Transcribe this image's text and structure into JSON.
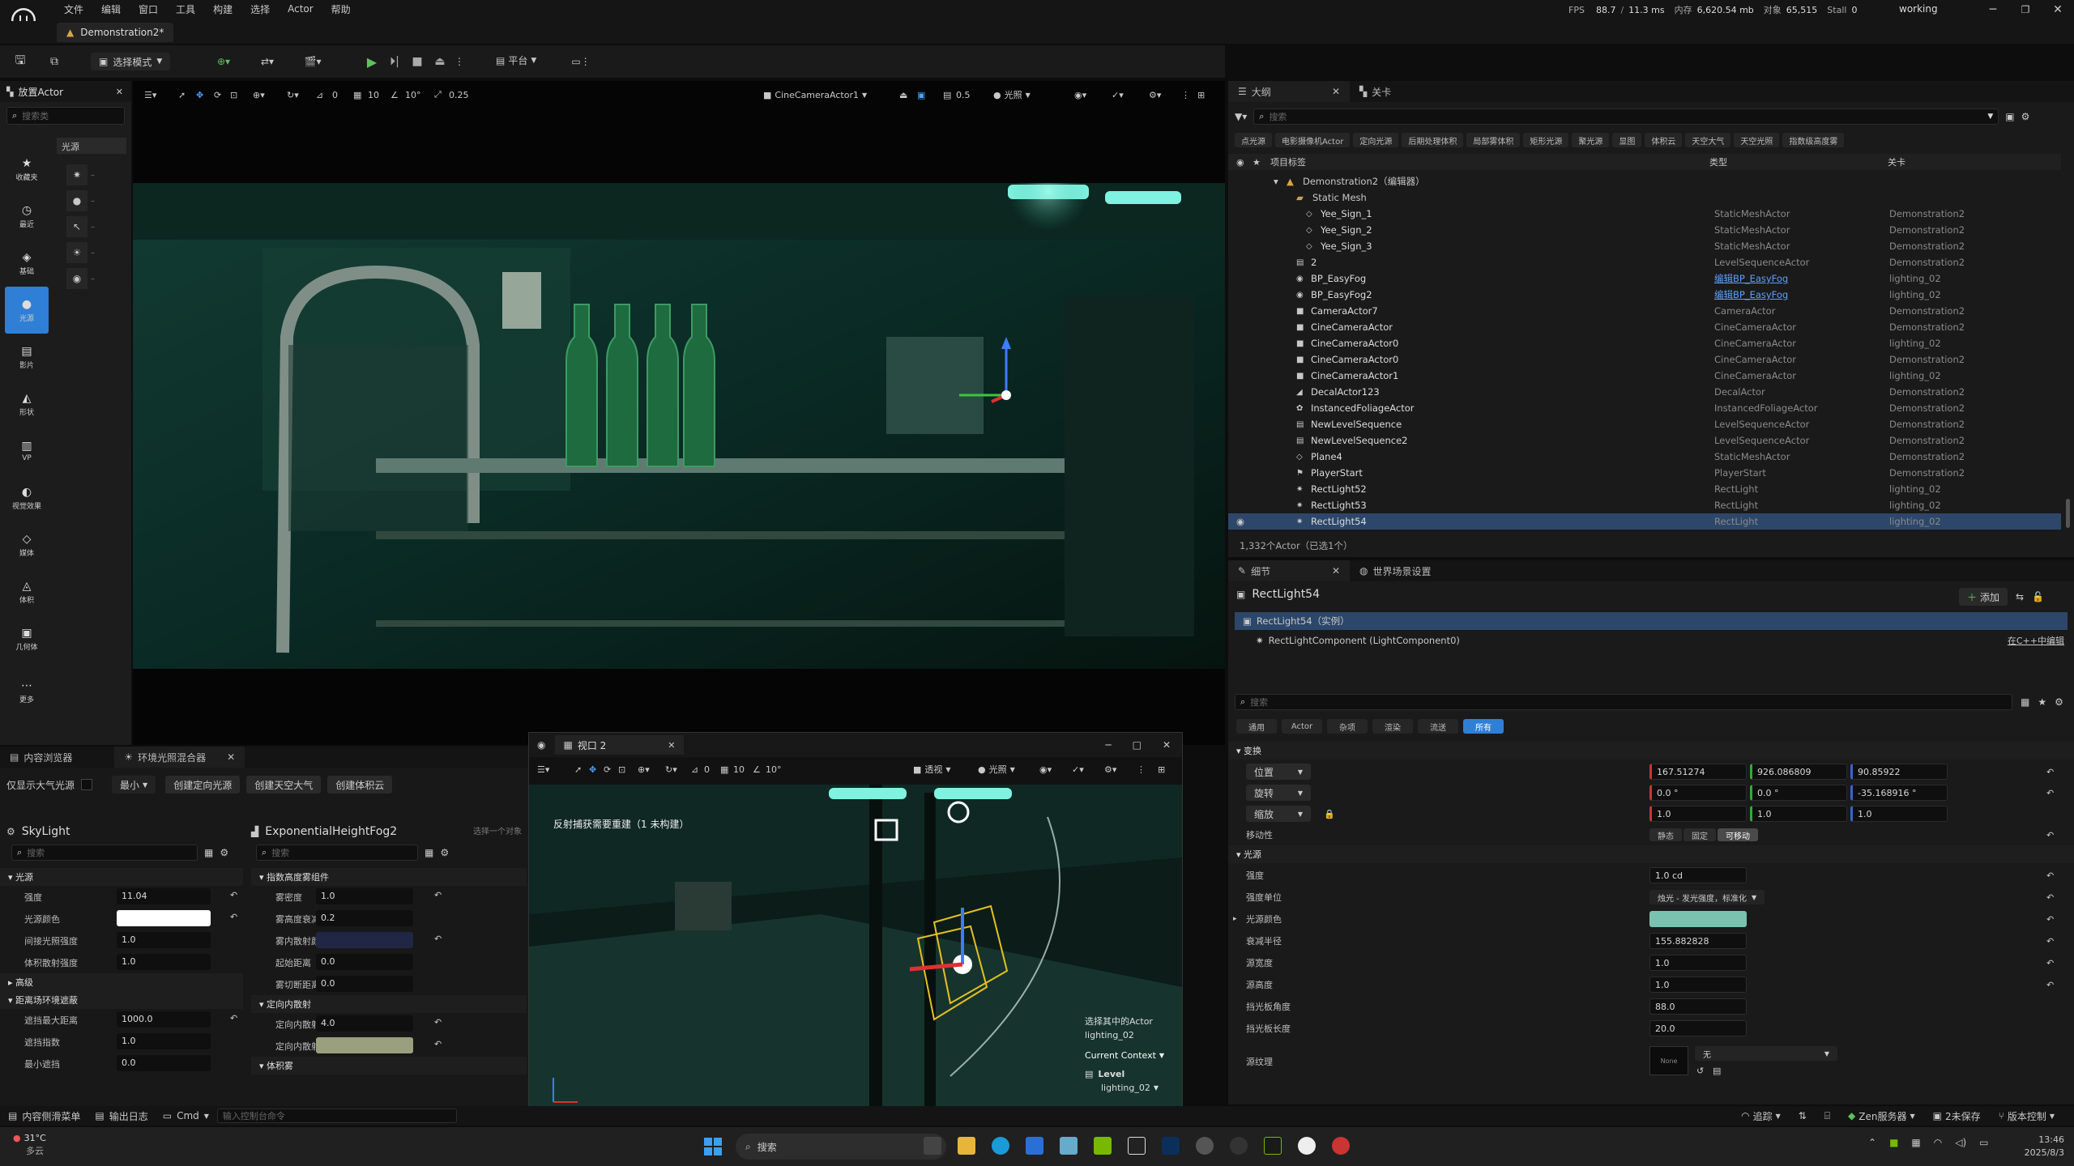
{
  "menu": {
    "items": [
      "文件",
      "编辑",
      "窗口",
      "工具",
      "构建",
      "选择",
      "Actor",
      "帮助"
    ],
    "fps_label": "FPS",
    "fps": "88.7",
    "frame_ms": "11.3 ms",
    "mem_label": "内存",
    "mem": "6,620.54 mb",
    "obj_label": "对象",
    "obj": "65,515",
    "stall_label": "Stall",
    "stall": "0",
    "status": "working"
  },
  "doc_tab": "Demonstration2*",
  "toolbar": {
    "select_mode": "选择模式",
    "platform": "平台"
  },
  "place_panel": {
    "tab": "放置Actor",
    "search_placeholder": "搜索类",
    "category_header": "光源",
    "categories": [
      "收藏夹",
      "最近",
      "基础",
      "光源",
      "影片",
      "形状",
      "VP",
      "视觉效果",
      "媒体",
      "体积",
      "几何体",
      "更多"
    ]
  },
  "viewport": {
    "camera": "CineCameraActor1",
    "snap_move": "10",
    "snap_rot": "10°",
    "snap_scale": "0.25",
    "speed": "0.5",
    "lit": "光照",
    "count_a": "0",
    "count_b": "10"
  },
  "viewport2": {
    "title": "视口 2",
    "perspective": "透视",
    "lit": "光照",
    "warning": "反射捕获需要重建（1 未构建）",
    "snap_a": "0",
    "snap_b": "10",
    "snap_c": "10°",
    "info_line1": "选择其中的Actor",
    "info_line2": "lighting_02",
    "context_label": "Current Context",
    "level_label": "Level",
    "level_value": "lighting_02"
  },
  "content_browser": {
    "tab1": "内容浏览器",
    "tab2": "环境光照混合器",
    "only_env": "仅显示大气光源",
    "min_label": "最小",
    "btn_dirlight": "创建定向光源",
    "btn_sky": "创建天空大气",
    "btn_volcloud": "创建体积云",
    "skylight": {
      "title": "SkyLight",
      "search": "搜索",
      "sec_light": "光源",
      "rows": [
        {
          "label": "强度",
          "value": "11.04"
        },
        {
          "label": "光源颜色",
          "value": ""
        },
        {
          "label": "间接光照强度",
          "value": "1.0"
        },
        {
          "label": "体积散射强度",
          "value": "1.0"
        }
      ],
      "sec_adv": "高级",
      "sec_dist": "距离场环境遮蔽",
      "rows2": [
        {
          "label": "遮挡最大距离",
          "value": "1000.0"
        },
        {
          "label": "遮挡指数",
          "value": "1.0"
        },
        {
          "label": "最小遮挡",
          "value": "0.0"
        }
      ]
    },
    "fog": {
      "title": "ExponentialHeightFog2",
      "search": "搜索",
      "hint": "选择一个对象",
      "sec_exp": "指数高度雾组件",
      "rows": [
        {
          "label": "雾密度",
          "value": "1.0"
        },
        {
          "label": "雾高度衰减",
          "value": "0.2"
        },
        {
          "label": "雾内散射颜色",
          "value": ""
        },
        {
          "label": "起始距离",
          "value": "0.0"
        },
        {
          "label": "雾切断距离",
          "value": "0.0"
        }
      ],
      "sec_dir": "定向内散射",
      "rows2": [
        {
          "label": "定向内散射指数",
          "value": "4.0"
        },
        {
          "label": "定向内散射颜色",
          "value": ""
        }
      ],
      "sec_vol": "体积雾"
    }
  },
  "outliner": {
    "tab1": "大纲",
    "tab2": "关卡",
    "search": "搜索",
    "filters": [
      "点光源",
      "电影摄像机Actor",
      "定向光源",
      "后期处理体积",
      "局部雾体积",
      "矩形光源",
      "聚光源",
      "显图",
      "体积云",
      "天空大气",
      "天空光照",
      "指数级高度雾"
    ],
    "col_label": "项目标签",
    "col_type": "类型",
    "col_level": "关卡",
    "root": "Demonstration2（编辑器）",
    "folder": "Static Mesh",
    "rows": [
      {
        "name": "Yee_Sign_1",
        "type": "StaticMeshActor",
        "level": "Demonstration2",
        "indent": 3
      },
      {
        "name": "Yee_Sign_2",
        "type": "StaticMeshActor",
        "level": "Demonstration2",
        "indent": 3
      },
      {
        "name": "Yee_Sign_3",
        "type": "StaticMeshActor",
        "level": "Demonstration2",
        "indent": 3
      },
      {
        "name": "2",
        "type": "LevelSequenceActor",
        "level": "Demonstration2",
        "indent": 2
      },
      {
        "name": "BP_EasyFog",
        "type": "编辑BP_EasyFog",
        "level": "lighting_02",
        "indent": 2,
        "link": true
      },
      {
        "name": "BP_EasyFog2",
        "type": "编辑BP_EasyFog",
        "level": "lighting_02",
        "indent": 2,
        "link": true
      },
      {
        "name": "CameraActor7",
        "type": "CameraActor",
        "level": "Demonstration2",
        "indent": 2
      },
      {
        "name": "CineCameraActor",
        "type": "CineCameraActor",
        "level": "Demonstration2",
        "indent": 2
      },
      {
        "name": "CineCameraActor0",
        "type": "CineCameraActor",
        "level": "lighting_02",
        "indent": 2
      },
      {
        "name": "CineCameraActor0",
        "type": "CineCameraActor",
        "level": "Demonstration2",
        "indent": 2
      },
      {
        "name": "CineCameraActor1",
        "type": "CineCameraActor",
        "level": "lighting_02",
        "indent": 2
      },
      {
        "name": "DecalActor123",
        "type": "DecalActor",
        "level": "Demonstration2",
        "indent": 2
      },
      {
        "name": "InstancedFoliageActor",
        "type": "InstancedFoliageActor",
        "level": "Demonstration2",
        "indent": 2
      },
      {
        "name": "NewLevelSequence",
        "type": "LevelSequenceActor",
        "level": "Demonstration2",
        "indent": 2
      },
      {
        "name": "NewLevelSequence2",
        "type": "LevelSequenceActor",
        "level": "Demonstration2",
        "indent": 2
      },
      {
        "name": "Plane4",
        "type": "StaticMeshActor",
        "level": "Demonstration2",
        "indent": 2
      },
      {
        "name": "PlayerStart",
        "type": "PlayerStart",
        "level": "Demonstration2",
        "indent": 2
      },
      {
        "name": "RectLight52",
        "type": "RectLight",
        "level": "lighting_02",
        "indent": 2
      },
      {
        "name": "RectLight53",
        "type": "RectLight",
        "level": "lighting_02",
        "indent": 2
      },
      {
        "name": "RectLight54",
        "type": "RectLight",
        "level": "lighting_02",
        "indent": 2,
        "selected": true
      }
    ],
    "footer": "1,332个Actor（已选1个）"
  },
  "details": {
    "tab1": "细节",
    "tab2": "世界场景设置",
    "actor_name": "RectLight54",
    "add_label": "添加",
    "instance": "RectLight54（实例）",
    "component": "RectLightComponent (LightComponent0)",
    "edit_cpp": "在C++中编辑",
    "search": "搜索",
    "filter_tabs": [
      "通用",
      "Actor",
      "杂项",
      "渲染",
      "流送",
      "所有"
    ],
    "sec_transform": "变换",
    "location_label": "位置",
    "location": [
      "167.51274",
      "926.086809",
      "90.85922"
    ],
    "rotation_label": "旋转",
    "rotation": [
      "0.0 °",
      "0.0 °",
      "-35.168916 °"
    ],
    "scale_label": "缩放",
    "scale": [
      "1.0",
      "1.0",
      "1.0"
    ],
    "mobility_label": "移动性",
    "mobility": [
      "静态",
      "固定",
      "可移动"
    ],
    "sec_light": "光源",
    "props": [
      {
        "label": "强度",
        "value": "1.0 cd"
      },
      {
        "label": "强度单位",
        "value": "烛光 - 发光强度，标准化"
      },
      {
        "label": "光源颜色",
        "value": ""
      },
      {
        "label": "衰减半径",
        "value": "155.882828"
      },
      {
        "label": "源宽度",
        "value": "1.0"
      },
      {
        "label": "源高度",
        "value": "1.0"
      },
      {
        "label": "挡光板角度",
        "value": "88.0"
      },
      {
        "label": "挡光板长度",
        "value": "20.0"
      },
      {
        "label": "源纹理",
        "value": "无"
      }
    ],
    "none_label": "None"
  },
  "status_bar": {
    "drawer": "内容侧滑菜单",
    "log": "输出日志",
    "cmd": "Cmd",
    "cmd_placeholder": "输入控制台命令",
    "trace": "追踪",
    "zen": "Zen服务器",
    "unsaved": "2未保存",
    "source": "版本控制"
  },
  "taskbar": {
    "search": "搜索",
    "weather": "31°C",
    "weather2": "多云",
    "time": "13:46",
    "date": "2025/8/3"
  },
  "colors": {
    "accent_blue": "#2f7fd6",
    "selected_row": "#2c4769",
    "light_teal": "#79c2b0",
    "fog_color": "#1f2744",
    "dir_scatter": "#9aa07e"
  }
}
